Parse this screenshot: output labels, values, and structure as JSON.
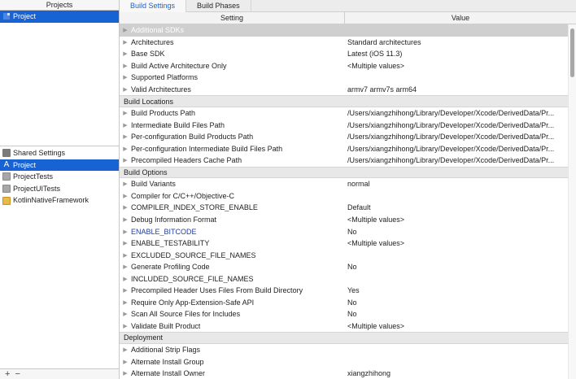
{
  "sidebar": {
    "projects_header": "Projects",
    "project": {
      "label": "Project",
      "icon": "xcode-project-icon"
    },
    "targets": [
      {
        "label": "Shared Settings",
        "icon": "shared-settings-icon",
        "selected": false
      },
      {
        "label": "Project",
        "icon": "app-target-icon",
        "selected": true
      },
      {
        "label": "ProjectTests",
        "icon": "test-bundle-icon",
        "selected": false
      },
      {
        "label": "ProjectUITests",
        "icon": "test-bundle-icon",
        "selected": false
      },
      {
        "label": "KotlinNativeFramework",
        "icon": "framework-icon",
        "selected": false
      }
    ],
    "footer": {
      "add": "+",
      "remove": "−"
    }
  },
  "tabs": [
    {
      "label": "Build Settings",
      "active": true
    },
    {
      "label": "Build Phases",
      "active": false
    }
  ],
  "columns": {
    "setting": "Setting",
    "value": "Value"
  },
  "rows": [
    {
      "type": "setting",
      "name": "Additional SDKs",
      "value": "",
      "selected": true
    },
    {
      "type": "setting",
      "name": "Architectures",
      "value": "Standard architectures"
    },
    {
      "type": "setting",
      "name": "Base SDK",
      "value": "Latest (iOS 11.3)"
    },
    {
      "type": "setting",
      "name": "Build Active Architecture Only",
      "value": "<Multiple values>"
    },
    {
      "type": "setting",
      "name": "Supported Platforms",
      "value": ""
    },
    {
      "type": "setting",
      "name": "Valid Architectures",
      "value": "armv7 armv7s arm64"
    },
    {
      "type": "section",
      "name": "Build Locations"
    },
    {
      "type": "setting",
      "name": "Build Products Path",
      "value": "/Users/xiangzhihong/Library/Developer/Xcode/DerivedData/Pr..."
    },
    {
      "type": "setting",
      "name": "Intermediate Build Files Path",
      "value": "/Users/xiangzhihong/Library/Developer/Xcode/DerivedData/Pr..."
    },
    {
      "type": "setting",
      "name": "Per-configuration Build Products Path",
      "value": "/Users/xiangzhihong/Library/Developer/Xcode/DerivedData/Pr..."
    },
    {
      "type": "setting",
      "name": "Per-configuration Intermediate Build Files Path",
      "value": "/Users/xiangzhihong/Library/Developer/Xcode/DerivedData/Pr..."
    },
    {
      "type": "setting",
      "name": "Precompiled Headers Cache Path",
      "value": "/Users/xiangzhihong/Library/Developer/Xcode/DerivedData/Pr..."
    },
    {
      "type": "section",
      "name": "Build Options"
    },
    {
      "type": "setting",
      "name": "Build Variants",
      "value": "normal"
    },
    {
      "type": "setting",
      "name": "Compiler for C/C++/Objective-C",
      "value": ""
    },
    {
      "type": "setting",
      "name": "COMPILER_INDEX_STORE_ENABLE",
      "value": "Default"
    },
    {
      "type": "setting",
      "name": "Debug Information Format",
      "value": "<Multiple values>"
    },
    {
      "type": "setting",
      "name": "ENABLE_BITCODE",
      "value": "No",
      "highlight": true
    },
    {
      "type": "setting",
      "name": "ENABLE_TESTABILITY",
      "value": "<Multiple values>"
    },
    {
      "type": "setting",
      "name": "EXCLUDED_SOURCE_FILE_NAMES",
      "value": ""
    },
    {
      "type": "setting",
      "name": "Generate Profiling Code",
      "value": "No"
    },
    {
      "type": "setting",
      "name": "INCLUDED_SOURCE_FILE_NAMES",
      "value": ""
    },
    {
      "type": "setting",
      "name": "Precompiled Header Uses Files From Build Directory",
      "value": "Yes"
    },
    {
      "type": "setting",
      "name": "Require Only App-Extension-Safe API",
      "value": "No"
    },
    {
      "type": "setting",
      "name": "Scan All Source Files for Includes",
      "value": "No"
    },
    {
      "type": "setting",
      "name": "Validate Built Product",
      "value": "<Multiple values>"
    },
    {
      "type": "section",
      "name": "Deployment"
    },
    {
      "type": "setting",
      "name": "Additional Strip Flags",
      "value": ""
    },
    {
      "type": "setting",
      "name": "Alternate Install Group",
      "value": ""
    },
    {
      "type": "setting",
      "name": "Alternate Install Owner",
      "value": "xiangzhihong"
    }
  ],
  "colors": {
    "accent": "#1863d3",
    "section_bg": "#e8e8e8",
    "highlight_text": "#1f3f9a"
  }
}
